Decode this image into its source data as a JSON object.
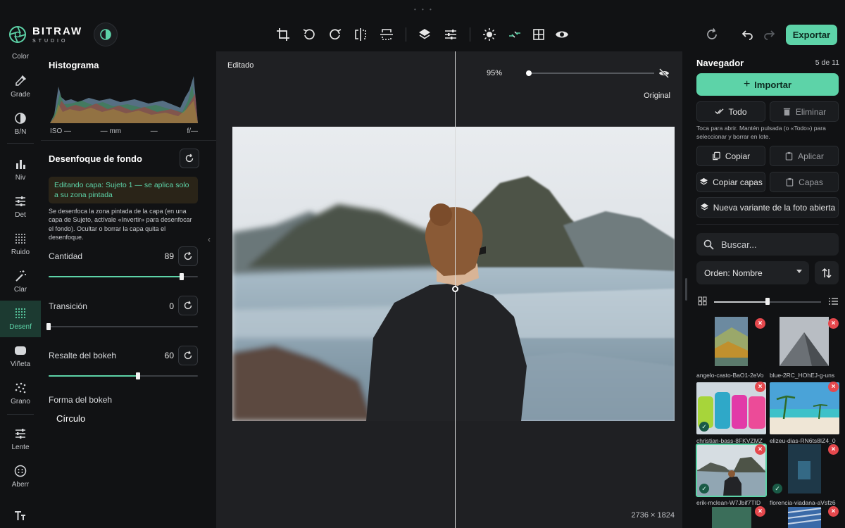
{
  "app": {
    "name": "BITRAW",
    "subtitle": "STUDIO",
    "export_label": "Exportar"
  },
  "toolbar": {
    "icons": [
      "crop-icon",
      "rotate-left-icon",
      "rotate-right-icon",
      "flip-horizontal-icon",
      "flip-vertical-icon",
      "layers-icon",
      "sliders-icon",
      "brightness-icon",
      "compare-icon",
      "grid-icon",
      "eye-icon",
      "refresh-icon",
      "undo-icon",
      "redo-icon"
    ]
  },
  "rail": {
    "items": [
      {
        "label": "Color",
        "icon": "color-icon"
      },
      {
        "label": "Grade",
        "icon": "eyedropper-icon"
      },
      {
        "label": "B/N",
        "icon": "half-circle-icon"
      },
      {
        "label": "Niv",
        "icon": "bar-chart-icon"
      },
      {
        "label": "Det",
        "icon": "sliders-icon"
      },
      {
        "label": "Ruido",
        "icon": "noise-grid-icon"
      },
      {
        "label": "Clar",
        "icon": "magic-wand-icon"
      },
      {
        "label": "Desenf",
        "icon": "blur-dots-icon"
      },
      {
        "label": "Viñeta",
        "icon": "vignette-icon"
      },
      {
        "label": "Grano",
        "icon": "grain-icon"
      },
      {
        "label": "Lente",
        "icon": "lens-sliders-icon"
      },
      {
        "label": "Aberr",
        "icon": "aberration-icon"
      },
      {
        "label": "",
        "icon": "text-icon"
      }
    ]
  },
  "histogram": {
    "title": "Histograma",
    "iso": "ISO —",
    "mm": "— mm",
    "dash": "—",
    "aperture": "f/—"
  },
  "blur": {
    "title": "Desenfoque de fondo",
    "notice": "Editando capa: Sujeto 1 — se aplica solo a su zona pintada",
    "description": "Se desenfoca la zona pintada de la capa (en una capa de Sujeto, actívale «Invertir» para desenfocar el fondo). Ocultar o borrar la capa quita el desenfoque.",
    "params": [
      {
        "label": "Cantidad",
        "value": "89",
        "fraction": 0.89
      },
      {
        "label": "Transición",
        "value": "0",
        "fraction": 0.0
      },
      {
        "label": "Resalte del bokeh",
        "value": "60",
        "fraction": 0.6
      }
    ],
    "shape_label": "Forma del bokeh",
    "shape_value": "Círculo"
  },
  "canvas": {
    "edited_label": "Editado",
    "original_label": "Original",
    "zoom": "95%",
    "dimensions": "2736 × 1824"
  },
  "navigator": {
    "title": "Navegador",
    "count": "5 de 11",
    "import_label": "Importar",
    "all_label": "Todo",
    "delete_label": "Eliminar",
    "help": "Toca para abrir. Mantén pulsada (o «Todo») para seleccionar y borrar en lote.",
    "copy_label": "Copiar",
    "apply_label": "Aplicar",
    "copy_layers_label": "Copiar capas",
    "layers_label": "Capas",
    "new_variant_label": "Nueva variante de la foto abierta",
    "search_placeholder": "Buscar...",
    "sort_label": "Orden: Nombre",
    "thumbs": [
      {
        "name": "angelo-casto-BaO1-2eVo",
        "edited": false,
        "selected": false
      },
      {
        "name": "blue-2RC_HOhEJ-g-uns",
        "edited": false,
        "selected": false
      },
      {
        "name": "christian-bass-8FKVZMZ",
        "edited": true,
        "selected": false
      },
      {
        "name": "elizeu-dias-RN6ts8IZ4_0",
        "edited": false,
        "selected": false
      },
      {
        "name": "erik-mclean-W7Jbif7TID",
        "edited": true,
        "selected": true
      },
      {
        "name": "florencia-viadana-aVsfz6",
        "edited": true,
        "selected": false
      }
    ]
  },
  "colors": {
    "accent": "#5dd3a8",
    "danger": "#e5484d",
    "background": "#111214",
    "canvas": "#1f2023"
  }
}
